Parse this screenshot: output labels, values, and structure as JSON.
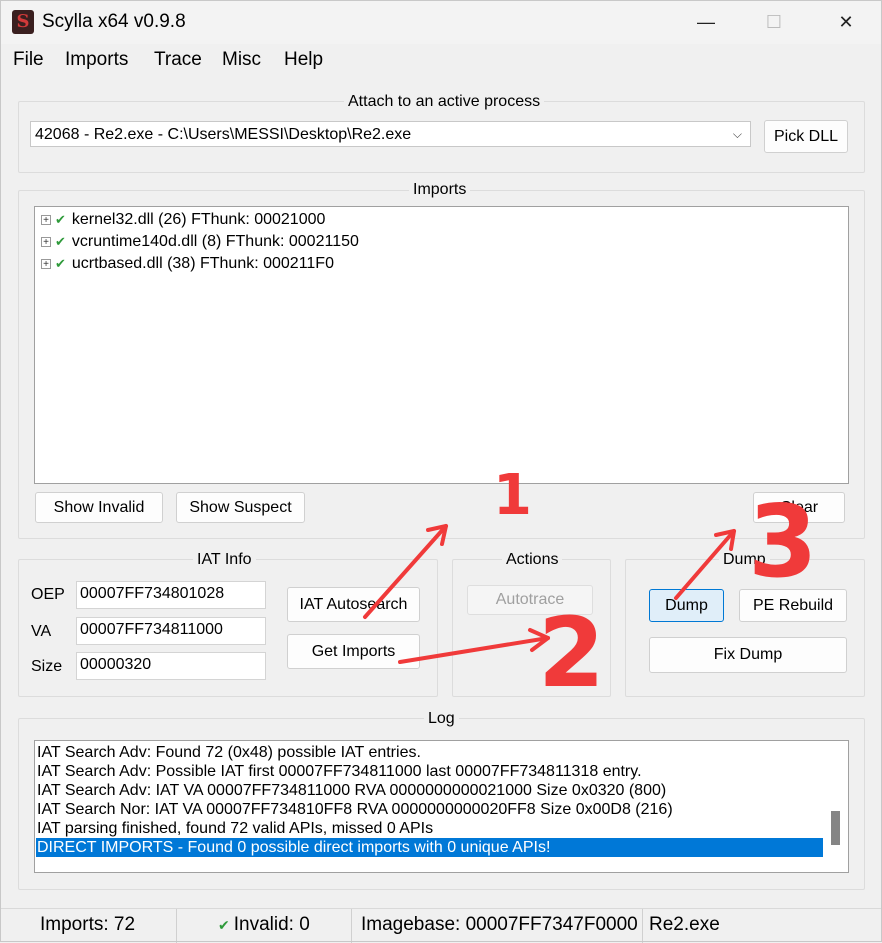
{
  "window": {
    "title": "Scylla x64 v0.9.8",
    "icon_letter": "S",
    "minimize": "—",
    "maximize": "☐",
    "close": "✕"
  },
  "menu": [
    "File",
    "Imports",
    "Trace",
    "Misc",
    "Help"
  ],
  "attach": {
    "title": "Attach to an active process",
    "process": "42068 - Re2.exe - C:\\Users\\MESSI\\Desktop\\Re2.exe",
    "pick_dll": "Pick DLL"
  },
  "imports": {
    "title": "Imports",
    "items": [
      "kernel32.dll (26) FThunk: 00021000",
      "vcruntime140d.dll (8) FThunk: 00021150",
      "ucrtbased.dll (38) FThunk: 000211F0"
    ],
    "show_invalid": "Show Invalid",
    "show_suspect": "Show Suspect",
    "clear": "Clear"
  },
  "iat_info": {
    "title": "IAT Info",
    "oep_label": "OEP",
    "oep_value": "00007FF734801028",
    "va_label": "VA",
    "va_value": "00007FF734811000",
    "size_label": "Size",
    "size_value": "00000320",
    "iat_autosearch": "IAT Autosearch",
    "get_imports": "Get Imports"
  },
  "actions": {
    "title": "Actions",
    "autotrace": "Autotrace"
  },
  "dump": {
    "title": "Dump",
    "dump": "Dump",
    "pe_rebuild": "PE Rebuild",
    "fix_dump": "Fix Dump"
  },
  "log": {
    "title": "Log",
    "lines": [
      "IAT Search Adv: Found 72 (0x48) possible IAT entries.",
      "IAT Search Adv: Possible IAT first 00007FF734811000 last 00007FF734811318 entry.",
      "IAT Search Adv: IAT VA 00007FF734811000 RVA 0000000000021000 Size 0x0320 (800)",
      "IAT Search Nor: IAT VA 00007FF734810FF8 RVA 0000000000020FF8 Size 0x00D8 (216)",
      "IAT parsing finished, found 72 valid APIs, missed 0 APIs"
    ],
    "selected_line": "DIRECT IMPORTS - Found 0 possible direct imports with 0 unique APIs!"
  },
  "status": {
    "imports": "Imports: 72",
    "invalid": "Invalid: 0",
    "imagebase": "Imagebase: 00007FF7347F0000",
    "module": "Re2.exe"
  },
  "annotations": {
    "color": "#f03a3a",
    "numbers": [
      "1",
      "2",
      "3"
    ]
  }
}
